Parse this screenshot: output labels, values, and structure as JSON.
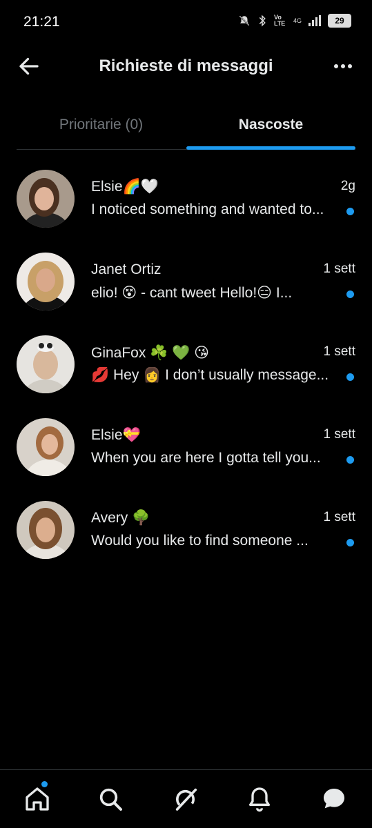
{
  "status": {
    "time": "21:21",
    "battery": "29",
    "volte": "Vo LTE",
    "network": "4G"
  },
  "header": {
    "title": "Richieste di messaggi",
    "back_icon": "arrow-left-icon",
    "more_icon": "more-horizontal-icon"
  },
  "tabs": [
    {
      "label": "Prioritarie (0)",
      "selected": false
    },
    {
      "label": "Nascoste",
      "selected": true
    }
  ],
  "colors": {
    "accent": "#1d9bf0",
    "background": "#000000",
    "text": "#e7e9ea",
    "muted": "#71767b"
  },
  "conversations": [
    {
      "name": "Elsie🌈🤍",
      "time": "2g",
      "preview": "I noticed something and wanted to...",
      "unread": true
    },
    {
      "name": "Janet Ortiz",
      "time": "1 sett",
      "preview": "elio! 😵 - cant tweet Hello!😑 I...",
      "unread": true
    },
    {
      "name": "GinaFox ☘️ 💚 😘",
      "time": "1 sett",
      "preview": "💋 Hey 👩 I don’t usually message...",
      "unread": true
    },
    {
      "name": "Elsie💝",
      "time": "1 sett",
      "preview": "When you are here I gotta tell you...",
      "unread": true
    },
    {
      "name": "Avery 🌳",
      "time": "1 sett",
      "preview": "Would you like to find someone ...",
      "unread": true
    }
  ],
  "bottom_nav": [
    {
      "icon": "home-icon",
      "badge": true
    },
    {
      "icon": "search-icon"
    },
    {
      "icon": "grok-icon"
    },
    {
      "icon": "bell-icon"
    },
    {
      "icon": "messages-icon"
    }
  ]
}
